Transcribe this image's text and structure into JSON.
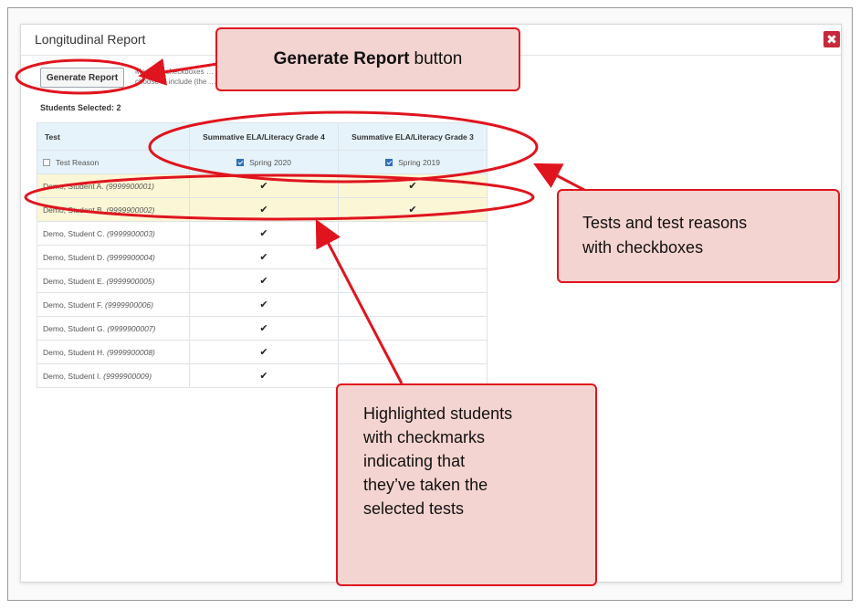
{
  "modal": {
    "title": "Longitudinal Report",
    "close_glyph": "✖",
    "generate_button_label": "Generate Report",
    "instructions_line1": "Mark the checkboxes … Longitudinal Report will only show data for students who completed every test you",
    "instructions_line2": "choose to include (the …",
    "students_selected": "Students Selected: 2"
  },
  "table": {
    "first_column_header": "Test",
    "tests": [
      {
        "name": "Summative ELA/Literacy Grade 4",
        "reason": "Spring 2020",
        "reason_checked": true
      },
      {
        "name": "Summative ELA/Literacy Grade 3",
        "reason": "Spring 2019",
        "reason_checked": true
      }
    ],
    "reason_row_label": "Test Reason",
    "rows": [
      {
        "student": "Demo, Student A.",
        "id": "(9999900001)",
        "highlighted": true,
        "marks": [
          "✔",
          "✔"
        ]
      },
      {
        "student": "Demo, Student B.",
        "id": "(9999900002)",
        "highlighted": true,
        "marks": [
          "✔",
          "✔"
        ]
      },
      {
        "student": "Demo, Student C.",
        "id": "(9999900003)",
        "highlighted": false,
        "marks": [
          "✔",
          ""
        ]
      },
      {
        "student": "Demo, Student D.",
        "id": "(9999900004)",
        "highlighted": false,
        "marks": [
          "✔",
          ""
        ]
      },
      {
        "student": "Demo, Student E.",
        "id": "(9999900005)",
        "highlighted": false,
        "marks": [
          "✔",
          ""
        ]
      },
      {
        "student": "Demo, Student F.",
        "id": "(9999900006)",
        "highlighted": false,
        "marks": [
          "✔",
          ""
        ]
      },
      {
        "student": "Demo, Student G.",
        "id": "(9999900007)",
        "highlighted": false,
        "marks": [
          "✔",
          ""
        ]
      },
      {
        "student": "Demo, Student H.",
        "id": "(9999900008)",
        "highlighted": false,
        "marks": [
          "✔",
          ""
        ]
      },
      {
        "student": "Demo, Student I.",
        "id": "(9999900009)",
        "highlighted": false,
        "marks": [
          "✔",
          ""
        ]
      }
    ]
  },
  "callouts": {
    "top_bold": "Generate Report",
    "top_rest": "button",
    "mid_lines": [
      "Tests and test reasons",
      "with checkboxes"
    ],
    "bot_lines": [
      "Highlighted students",
      "with checkmarks",
      "indicating that",
      "they’ve taken the",
      "selected tests"
    ]
  },
  "colors": {
    "annotation_red": "#e0141e",
    "callout_fill": "#f4d4d0",
    "header_blue": "#e6f3fa",
    "highlight_yellow": "#fbf6d6",
    "checkbox_blue": "#2e6fbe",
    "close_red": "#c8283c"
  },
  "icons": {
    "close": "close-icon",
    "check": "checkmark-icon",
    "checkbox": "checkbox-icon"
  }
}
